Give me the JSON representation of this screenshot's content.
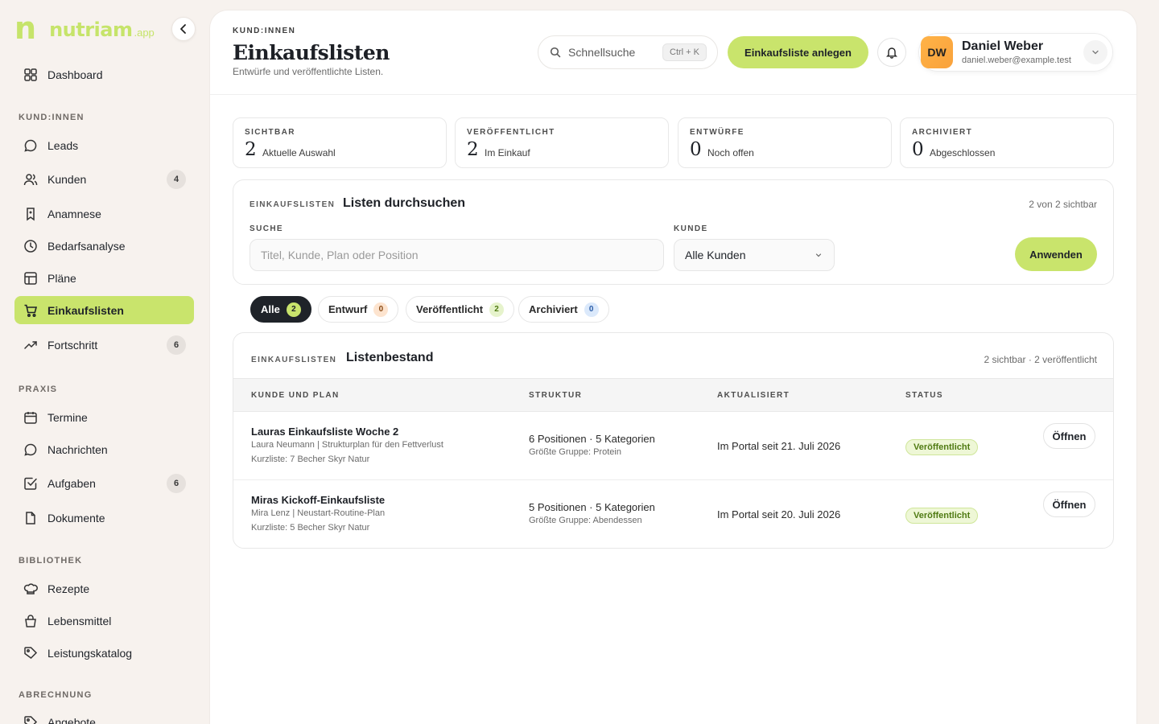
{
  "brand": {
    "mark": "n",
    "word": "nutriam",
    "suffix": ".app"
  },
  "sidebar": {
    "top": {
      "label": "Dashboard",
      "icon": "grid-icon"
    },
    "sections": [
      {
        "title": "KUND:INNEN",
        "items": [
          {
            "label": "Leads",
            "icon": "chat-icon",
            "badge": null
          },
          {
            "label": "Kunden",
            "icon": "users-icon",
            "badge": "4"
          },
          {
            "label": "Anamnese",
            "icon": "bookmark-icon",
            "badge": null
          },
          {
            "label": "Bedarfsanalyse",
            "icon": "clock-icon",
            "badge": null
          },
          {
            "label": "Pläne",
            "icon": "table-icon",
            "badge": null
          },
          {
            "label": "Einkaufslisten",
            "icon": "cart-icon",
            "badge": null,
            "active": true
          },
          {
            "label": "Fortschritt",
            "icon": "trend-icon",
            "badge": "6"
          }
        ]
      },
      {
        "title": "PRAXIS",
        "items": [
          {
            "label": "Termine",
            "icon": "calendar-icon",
            "badge": null
          },
          {
            "label": "Nachrichten",
            "icon": "message-icon",
            "badge": null
          },
          {
            "label": "Aufgaben",
            "icon": "check-square-icon",
            "badge": "6"
          },
          {
            "label": "Dokumente",
            "icon": "file-icon",
            "badge": null
          }
        ]
      },
      {
        "title": "BIBLIOTHEK",
        "items": [
          {
            "label": "Rezepte",
            "icon": "chef-hat-icon",
            "badge": null
          },
          {
            "label": "Lebensmittel",
            "icon": "basket-icon",
            "badge": null
          },
          {
            "label": "Leistungskatalog",
            "icon": "tag-icon",
            "badge": null
          }
        ]
      },
      {
        "title": "ABRECHNUNG",
        "items": [
          {
            "label": "Angebote",
            "icon": "tag-icon",
            "badge": null
          }
        ]
      }
    ]
  },
  "header": {
    "kicker": "KUND:INNEN",
    "title": "Einkaufslisten",
    "subtitle": "Entwürfe und veröffentlichte Listen.",
    "search_label": "Schnellsuche",
    "search_shortcut": "Ctrl + K",
    "cta_label": "Einkaufsliste anlegen",
    "user": {
      "initials": "DW",
      "name": "Daniel Weber",
      "email": "daniel.weber@example.test"
    }
  },
  "stats": [
    {
      "key": "SICHTBAR",
      "value": "2",
      "desc": "Aktuelle Auswahl"
    },
    {
      "key": "VERÖFFENTLICHT",
      "value": "2",
      "desc": "Im Einkauf"
    },
    {
      "key": "ENTWÜRFE",
      "value": "0",
      "desc": "Noch offen"
    },
    {
      "key": "ARCHIVIERT",
      "value": "0",
      "desc": "Abgeschlossen"
    }
  ],
  "filter": {
    "kicker": "EINKAUFSLISTEN",
    "title": "Listen durchsuchen",
    "visible": "2 von 2 sichtbar",
    "search_label": "SUCHE",
    "search_placeholder": "Titel, Kunde, Plan oder Position",
    "customer_label": "KUNDE",
    "customer_value": "Alle Kunden",
    "apply_label": "Anwenden"
  },
  "chips": [
    {
      "label": "Alle",
      "count": "2",
      "active": true,
      "color": "#c9e46c",
      "text": "#1f2329"
    },
    {
      "label": "Entwurf",
      "count": "0",
      "active": false,
      "color": "#fde4cf",
      "text": "#8a4a14"
    },
    {
      "label": "Veröffentlicht",
      "count": "2",
      "active": false,
      "color": "#e6f3cc",
      "text": "#4f7a12"
    },
    {
      "label": "Archiviert",
      "count": "0",
      "active": false,
      "color": "#dbe9fb",
      "text": "#2b5da8"
    }
  ],
  "list": {
    "kicker": "EINKAUFSLISTEN",
    "title": "Listenbestand",
    "summary": "2 sichtbar · 2 veröffentlicht",
    "columns": [
      "KUNDE UND PLAN",
      "STRUKTUR",
      "AKTUALISIERT",
      "STATUS"
    ],
    "rows": [
      {
        "title": "Lauras Einkaufsliste Woche 2",
        "sub": "Laura Neumann | Strukturplan für den Fettverlust",
        "short": "Kurzliste: 7 Becher Skyr Natur",
        "struct": "6 Positionen · 5 Kategorien",
        "group": "Größte Gruppe: Protein",
        "updated": "Im Portal seit 21. Juli 2026",
        "status": "Veröffentlicht",
        "action": "Öffnen"
      },
      {
        "title": "Miras Kickoff-Einkaufsliste",
        "sub": "Mira Lenz | Neustart-Routine-Plan",
        "short": "Kurzliste: 5 Becher Skyr Natur",
        "struct": "5 Positionen · 5 Kategorien",
        "group": "Größte Gruppe: Abendessen",
        "updated": "Im Portal seit 20. Juli 2026",
        "status": "Veröffentlicht",
        "action": "Öffnen"
      }
    ]
  }
}
